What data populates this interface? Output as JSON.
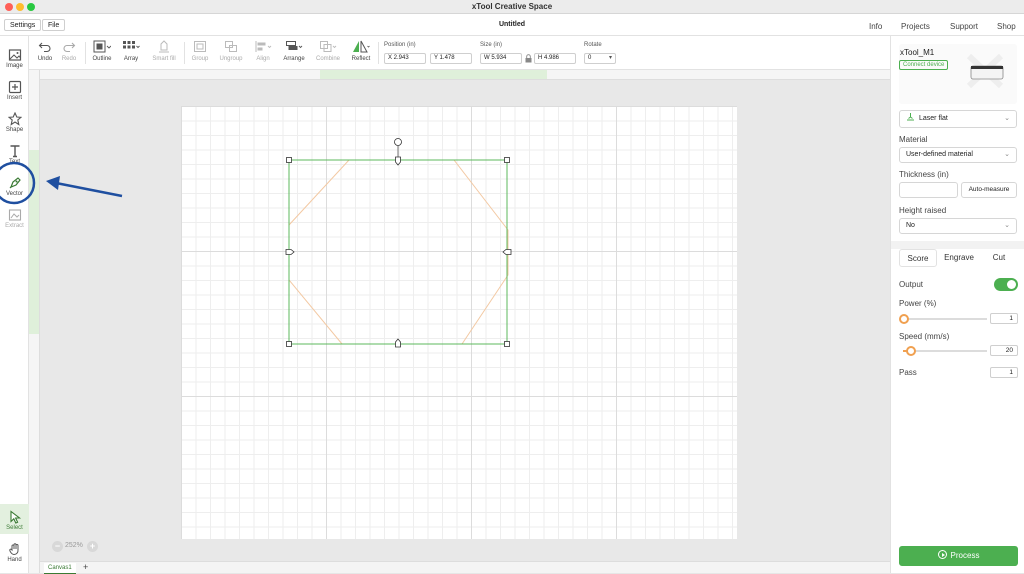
{
  "window": {
    "app_title": "xTool Creative Space"
  },
  "menubar": {
    "settings_label": "Settings",
    "file_label": "File",
    "document_title": "Untitled",
    "nav": [
      "Info",
      "Projects",
      "Support",
      "Shop"
    ]
  },
  "left_tools": [
    {
      "label": "Image",
      "icon": "image-icon"
    },
    {
      "label": "Insert",
      "icon": "insert-icon"
    },
    {
      "label": "Shape",
      "icon": "shape-icon"
    },
    {
      "label": "Text",
      "icon": "text-icon"
    },
    {
      "label": "Vector",
      "icon": "pen-icon"
    },
    {
      "label": "Extract",
      "icon": "extract-icon"
    },
    {
      "label": "Select",
      "icon": "select-cursor-icon"
    },
    {
      "label": "Hand",
      "icon": "hand-icon"
    }
  ],
  "toolbar": {
    "undo": "Undo",
    "redo": "Redo",
    "outline": "Outline",
    "array": "Array",
    "smart_fill": "Smart fill",
    "group": "Group",
    "ungroup": "Ungroup",
    "align": "Align",
    "arrange": "Arrange",
    "combine": "Combine",
    "reflect": "Reflect",
    "position_label": "Position (in)",
    "x_value": "X 2.943",
    "y_value": "Y 1.478",
    "size_label": "Size (in)",
    "w_value": "W 5.934",
    "h_value": "H 4.986",
    "rotate_label": "Rotate",
    "rotate_value": "0"
  },
  "canvas": {
    "zoom_label": "252%",
    "tab_label": "Canvas1",
    "add_tab": "+"
  },
  "right_panel": {
    "device_name": "xTool_M1",
    "connect_label": "Connect device",
    "mode": "Laser flat",
    "material_label": "Material",
    "material_value": "User-defined material",
    "thickness_label": "Thickness (in)",
    "auto_measure": "Auto-measure",
    "height_raised_label": "Height raised",
    "height_raised_value": "No",
    "tabs": [
      "Score",
      "Engrave",
      "Cut"
    ],
    "active_tab": "Score",
    "output_label": "Output",
    "output_on": true,
    "power_label": "Power (%)",
    "power_value": "1",
    "speed_label": "Speed (mm/s)",
    "speed_value": "20",
    "pass_label": "Pass",
    "pass_value": "1",
    "process_label": "Process"
  },
  "colors": {
    "accent": "#4caf50",
    "selection": "#4caf50",
    "path": "#f0b080",
    "annotation": "#1f4fa0"
  }
}
